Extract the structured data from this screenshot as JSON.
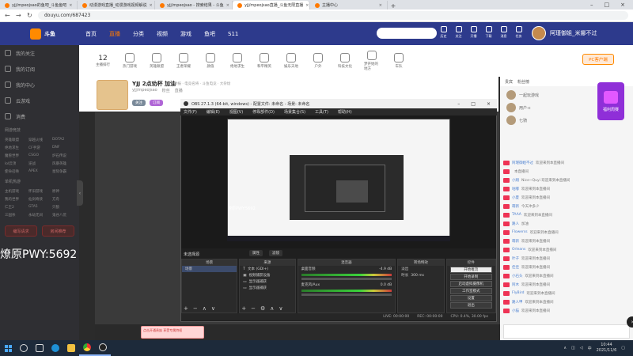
{
  "browser": {
    "tabs": [
      {
        "label": "yjj/mpeojsao的鱼吧_斗鱼鱼吧"
      },
      {
        "label": "动漫游戏直播_动漫游戏视频解说"
      },
      {
        "label": "yjj/mpeojsao - 搜索结果 - 斗鱼"
      },
      {
        "label": "yjj/mpeojsao直播_斗鱼无限直播"
      },
      {
        "label": "主播中心"
      }
    ],
    "active_tab": 3,
    "url": "douyu.com/687423"
  },
  "site": {
    "logo_text": "斗鱼",
    "nav": [
      "首页",
      "直播",
      "分类",
      "视频",
      "游戏",
      "鱼吧",
      "S11"
    ],
    "header_icons": [
      "历史",
      "关注",
      "开播",
      "下载",
      "消息",
      "任务"
    ],
    "user_name": "阿瑾御姐_米娜不过",
    "categories": [
      "主播排行",
      "热门游戏",
      "英雄联盟",
      "王者荣耀",
      "颜值",
      "绝地求生",
      "和平精英",
      "娱乐天地",
      "户外",
      "科技文化",
      "梦开始的地方",
      "车队",
      "PC客户端"
    ],
    "category_count": "12",
    "pc_client": "PC客户端"
  },
  "sidebar": {
    "top_items": [
      "我的关注",
      "我的订阅",
      "我的中心",
      "云游戏",
      "消费"
    ],
    "section1_title": "网游竞技",
    "section1_items": [
      "英雄联盟",
      "穿越火线",
      "DOTA2",
      "绝地求生",
      "CF手游",
      "DNF",
      "魔兽世界",
      "CSGO",
      "炉石传说",
      "lol云顶",
      "逆战",
      "风暴英雄",
      "使命召唤",
      "APEX",
      "星际争霸"
    ],
    "section2_title": "单机热游",
    "section2_items": [
      "主机游戏",
      "怀旧游戏",
      "原神",
      "我的世界",
      "仙剑奇侠",
      "方舟",
      "仁王2",
      "GTA5",
      "只狼",
      "三国杀",
      "永劫无间",
      "鬼谷八荒"
    ],
    "buttons": [
      "编写请求",
      "房间推荐"
    ]
  },
  "room": {
    "title": "YJJ 2点劝杯 加油",
    "subtitle": "举报 · 电竞名将 · 斗鱼电竞 · 大杂烩",
    "tags": [
      "yjj/mpeojsao",
      "粉丝",
      "直播"
    ],
    "follow_label": "关注",
    "subscribe_label": "订阅",
    "promo_text": "点击开通贵族 享受专属特权"
  },
  "rank_panel": {
    "header_tabs": [
      "贵宾",
      "粉丝榜"
    ],
    "names": [
      "一起玩游戏",
      "用户-c",
      "七骑"
    ]
  },
  "chat": {
    "lines": [
      {
        "name": "阿瑾御姐不过",
        "text": "欢迎来到本直播间"
      },
      {
        "name": "",
        "text": "本直播间"
      },
      {
        "name": "小翔",
        "text": "Nice~Quyi 欢迎来到本直播间"
      },
      {
        "name": "咕嘟",
        "text": "欢迎来到本直播间"
      },
      {
        "name": "小夏",
        "text": "欢迎来到本直播间"
      },
      {
        "name": "萌新",
        "text": "今天冲多少"
      },
      {
        "name": "TAAA",
        "text": "欢迎来到本直播间"
      },
      {
        "name": "路人",
        "text": "加油"
      },
      {
        "name": "Flowerss",
        "text": "欢迎来到本直播间"
      },
      {
        "name": "萌新",
        "text": "欢迎来到本直播间"
      },
      {
        "name": "Orleans",
        "text": "欢迎来到本直播间"
      },
      {
        "name": "叶子",
        "text": "欢迎来到本直播间"
      },
      {
        "name": "佳佳",
        "text": "欢迎来到本直播间"
      },
      {
        "name": "小石头",
        "text": "欢迎来到本直播间"
      },
      {
        "name": "阿木",
        "text": "欢迎来到本直播间"
      },
      {
        "name": "FlyBird",
        "text": "欢迎来到本直播间"
      },
      {
        "name": "路人甲",
        "text": "欢迎来到本直播间"
      },
      {
        "name": "小猫",
        "text": "欢迎来到本直播间"
      }
    ],
    "promo_badge": "福利周赛"
  },
  "obs": {
    "title": "OBS 27.1.3 (64-bit, windows) - 配置文件: 未命名 - 场景: 未命名",
    "menu": [
      "文件(F)",
      "编辑(E)",
      "视图(V)",
      "停靠部件(D)",
      "场景集合(S)",
      "工具(T)",
      "帮助(H)"
    ],
    "overlay_label": "燎原PWY:5692",
    "source_label": "未选择源",
    "filter_buttons": [
      "属性",
      "滤镜"
    ],
    "docks": {
      "scenes": {
        "title": "场景",
        "items": [
          "场景"
        ]
      },
      "sources": {
        "title": "来源",
        "items": [
          "文本 (GDI+)",
          "视频捕获设备",
          "显示器捕获",
          "显示器捕获"
        ]
      },
      "mixer": {
        "title": "混音器",
        "channels": [
          {
            "name": "桌面音频",
            "db": "-4.9 dB"
          },
          {
            "name": "麦克风/Aux",
            "db": "0.0 dB"
          }
        ]
      },
      "transitions": {
        "title": "转场特效",
        "type": "淡出",
        "duration_label": "时长",
        "duration": "300 ms"
      },
      "controls": {
        "title": "控件",
        "buttons": [
          "开始推流",
          "开始录制",
          "启动虚拟摄像机",
          "工作室模式",
          "设置",
          "退出"
        ]
      }
    },
    "status": [
      "LIVE: 00:00:00",
      "REC: 00:00:00",
      "CPU: 0.4%, 30.00 fps"
    ]
  },
  "big_overlay_text": "燎原PWY:5692",
  "taskbar": {
    "time": "10:44",
    "date": "2021/11/6",
    "tray_text": "中"
  }
}
